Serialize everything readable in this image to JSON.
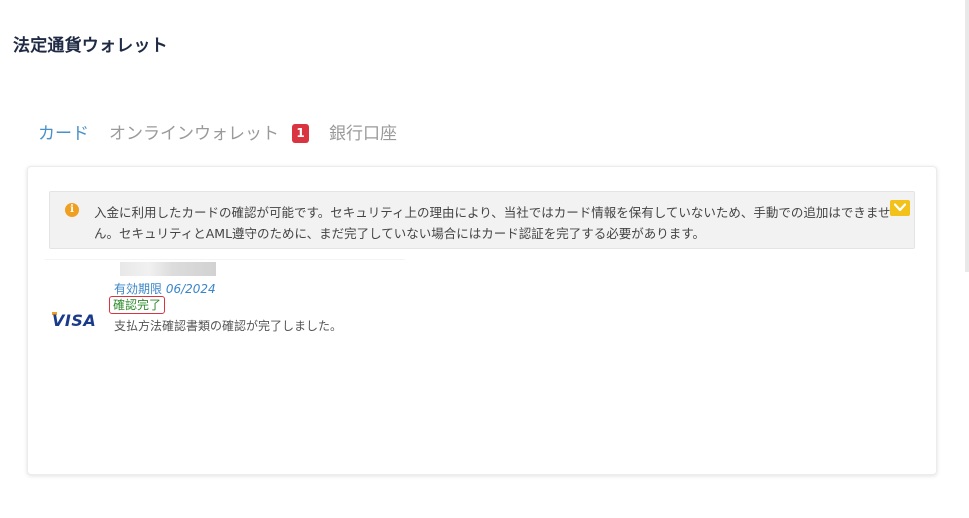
{
  "page": {
    "title": "法定通貨ウォレット"
  },
  "tabs": [
    {
      "label": "カード",
      "active": true
    },
    {
      "label": "オンラインウォレット",
      "active": false,
      "badge": "1"
    },
    {
      "label": "銀行口座",
      "active": false
    }
  ],
  "notice": {
    "icon": "info-icon",
    "icon_glyph": "i",
    "text": "入金に利用したカードの確認が可能です。セキュリティ上の理由により、当社ではカード情報を保有していないため、手動での追加はできません。セキュリティとAML遵守のために、まだ完了していない場合にはカード認証を完了する必要があります。",
    "expand_icon": "chevron-down-icon"
  },
  "card": {
    "brand": "VISA",
    "expiry_label": "有効期限",
    "expiry_date": "06/2024",
    "status": "確認完了",
    "status_description": "支払方法確認書類の確認が完了しました。"
  },
  "colors": {
    "accent": "#4a90c8",
    "badge": "#d9343f",
    "notice_icon": "#f0a020",
    "expand_button": "#f2c21a",
    "status_text": "#2e8b2e"
  }
}
